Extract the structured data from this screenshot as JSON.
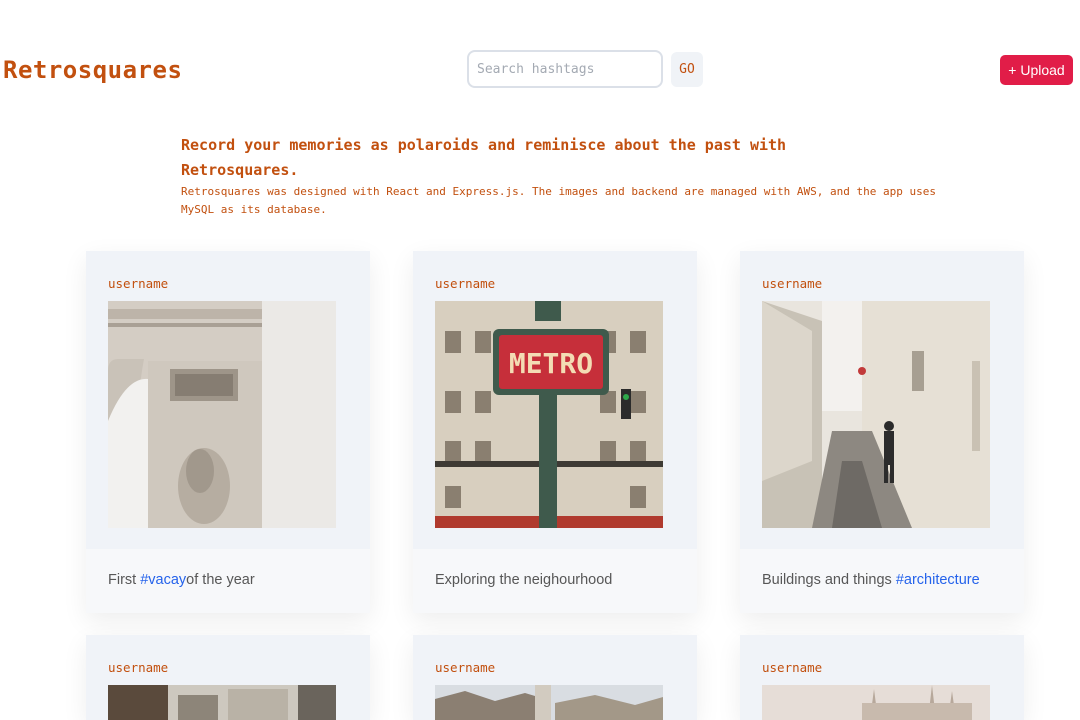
{
  "header": {
    "brand": "Retrosquares",
    "search_placeholder": "Search hashtags",
    "search_value": "",
    "go_label": "GO",
    "upload_label": "+ Upload"
  },
  "intro": {
    "title": "Record your memories as polaroids and reminisce about the past with Retrosquares.",
    "description": "Retrosquares was designed with React and Express.js. The images and backend are managed with AWS, and the app uses MySQL as its database."
  },
  "posts": [
    {
      "username": "username",
      "photo": "arc-de-triomphe-photo",
      "caption_before": "First ",
      "caption_tag": "#vacay",
      "caption_after": "of the year"
    },
    {
      "username": "username",
      "photo": "metro-sign-photo",
      "caption_before": "Exploring the neighourhood",
      "caption_tag": "",
      "caption_after": ""
    },
    {
      "username": "username",
      "photo": "cobblestone-alley-photo",
      "caption_before": "Buildings and things ",
      "caption_tag": "#architecture",
      "caption_after": ""
    },
    {
      "username": "username",
      "photo": "street-photo"
    },
    {
      "username": "username",
      "photo": "rooftops-photo"
    },
    {
      "username": "username",
      "photo": "cathedral-photo"
    }
  ],
  "colors": {
    "accent": "#c2500f",
    "upload": "#e11d48",
    "hashtag": "#2563eb",
    "card_bg": "#f0f3f8"
  }
}
